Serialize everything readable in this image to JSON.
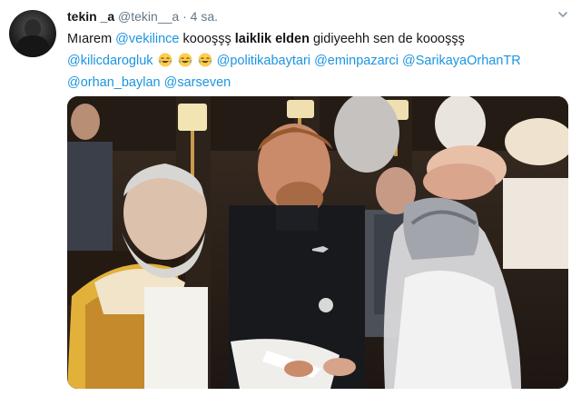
{
  "tweet": {
    "display_name": "tekin _a",
    "handle": "@tekin__a",
    "separator": "·",
    "time": "4 sa.",
    "body": {
      "prefix": "Mıarem ",
      "mention_1": "@vekilince",
      "text_1": " koooşşş ",
      "bold_1": "laiklik elden",
      "text_2": " gidiyeehh sen de koooşşş",
      "mentions": [
        "@kilicdarogluk",
        "@politikabaytari",
        "@eminpazarci",
        "@SarikayaOrhanTR",
        "@orhan_baylan",
        "@sarseven"
      ],
      "emoji_name": "face-with-tears-of-joy",
      "emoji_count": 3
    },
    "icons": {
      "menu": "chevron-down-icon"
    },
    "colors": {
      "link": "#1b95e0",
      "meta": "#657786",
      "text": "#14171a"
    }
  }
}
